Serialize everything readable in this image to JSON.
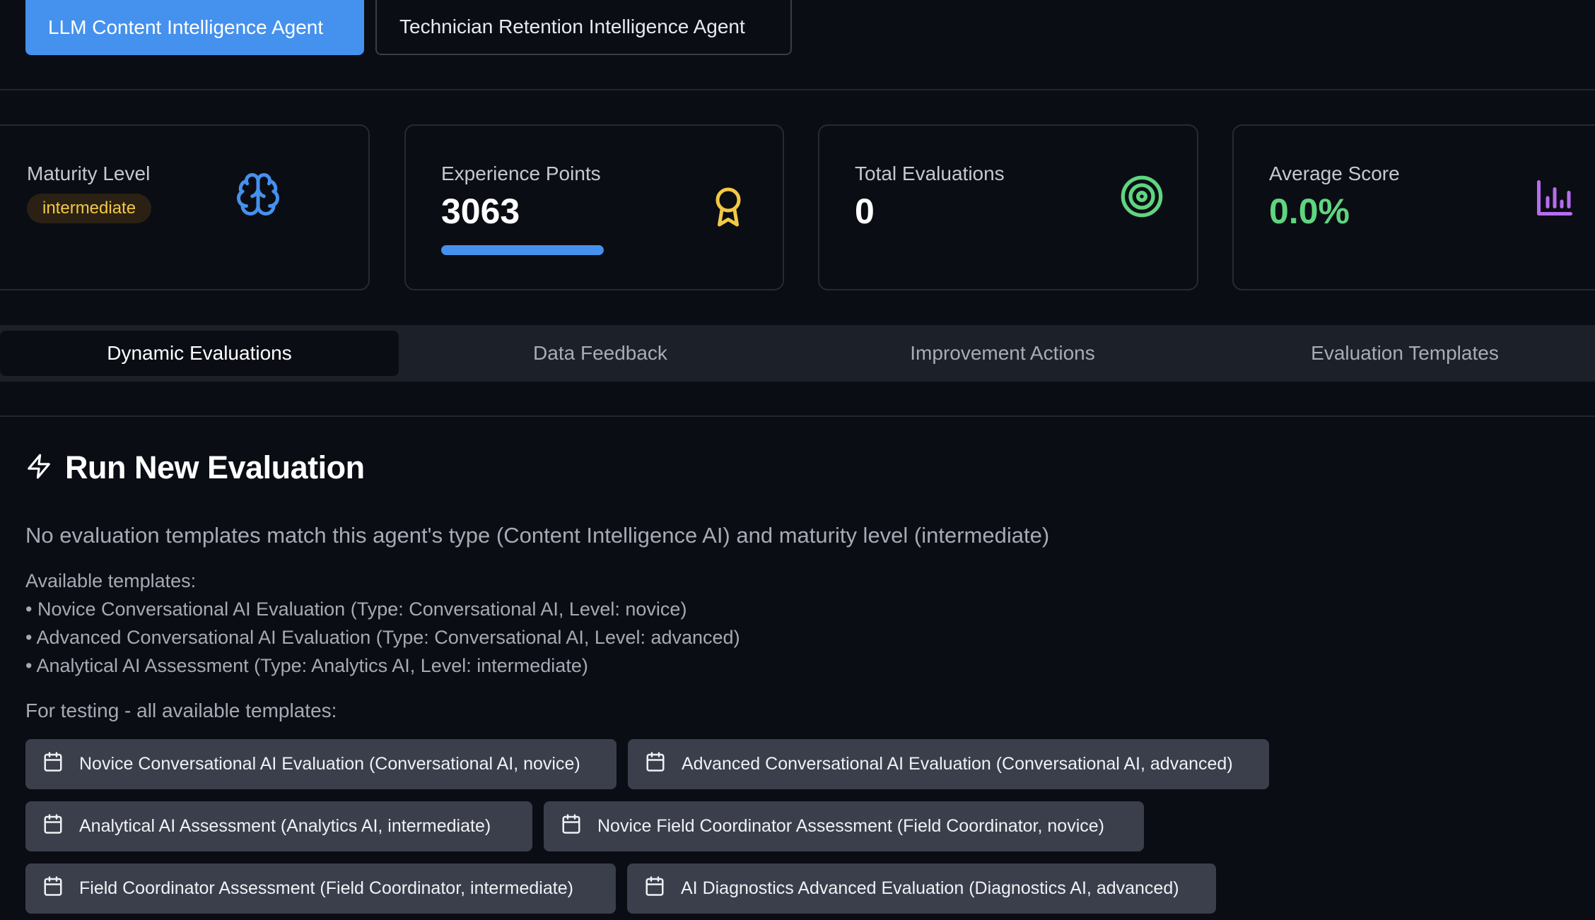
{
  "agents": [
    {
      "label": "LLM Content Intelligence Agent",
      "active": true
    },
    {
      "label": "Technician Retention Intelligence Agent",
      "active": false
    }
  ],
  "stats": {
    "maturity": {
      "label": "Maturity Level",
      "value": "intermediate",
      "icon": "brain-icon"
    },
    "experience": {
      "label": "Experience Points",
      "value": "3063",
      "icon": "award-icon",
      "progress": 1.0
    },
    "evaluations": {
      "label": "Total Evaluations",
      "value": "0",
      "icon": "target-icon"
    },
    "average": {
      "label": "Average Score",
      "value": "0.0%",
      "icon": "bar-chart-icon"
    }
  },
  "tabs": [
    {
      "label": "Dynamic Evaluations",
      "active": true
    },
    {
      "label": "Data Feedback",
      "active": false
    },
    {
      "label": "Improvement Actions",
      "active": false
    },
    {
      "label": "Evaluation Templates",
      "active": false
    }
  ],
  "section": {
    "title": "Run New Evaluation",
    "icon": "zap-icon",
    "no_templates": "No evaluation templates match this agent's type (Content Intelligence AI) and maturity level (intermediate)",
    "available_heading": "Available templates:",
    "available": [
      "• Novice Conversational AI Evaluation (Type: Conversational AI, Level: novice)",
      "• Advanced Conversational AI Evaluation (Type: Conversational AI, Level: advanced)",
      "• Analytical AI Assessment (Type: Analytics AI, Level: intermediate)"
    ],
    "testing_label": "For testing - all available templates:",
    "template_buttons": [
      "Novice Conversational AI Evaluation (Conversational AI, novice)",
      "Advanced Conversational AI Evaluation (Conversational AI, advanced)",
      "Analytical AI Assessment (Analytics AI, intermediate)",
      "Novice Field Coordinator Assessment (Field Coordinator, novice)",
      "Field Coordinator Assessment (Field Coordinator, intermediate)",
      "AI Diagnostics Advanced Evaluation (Diagnostics AI, advanced)"
    ]
  },
  "colors": {
    "accent": "#4591ee",
    "badge_text": "#f3c844",
    "success": "#5fd57f",
    "purple": "#b66df0"
  }
}
